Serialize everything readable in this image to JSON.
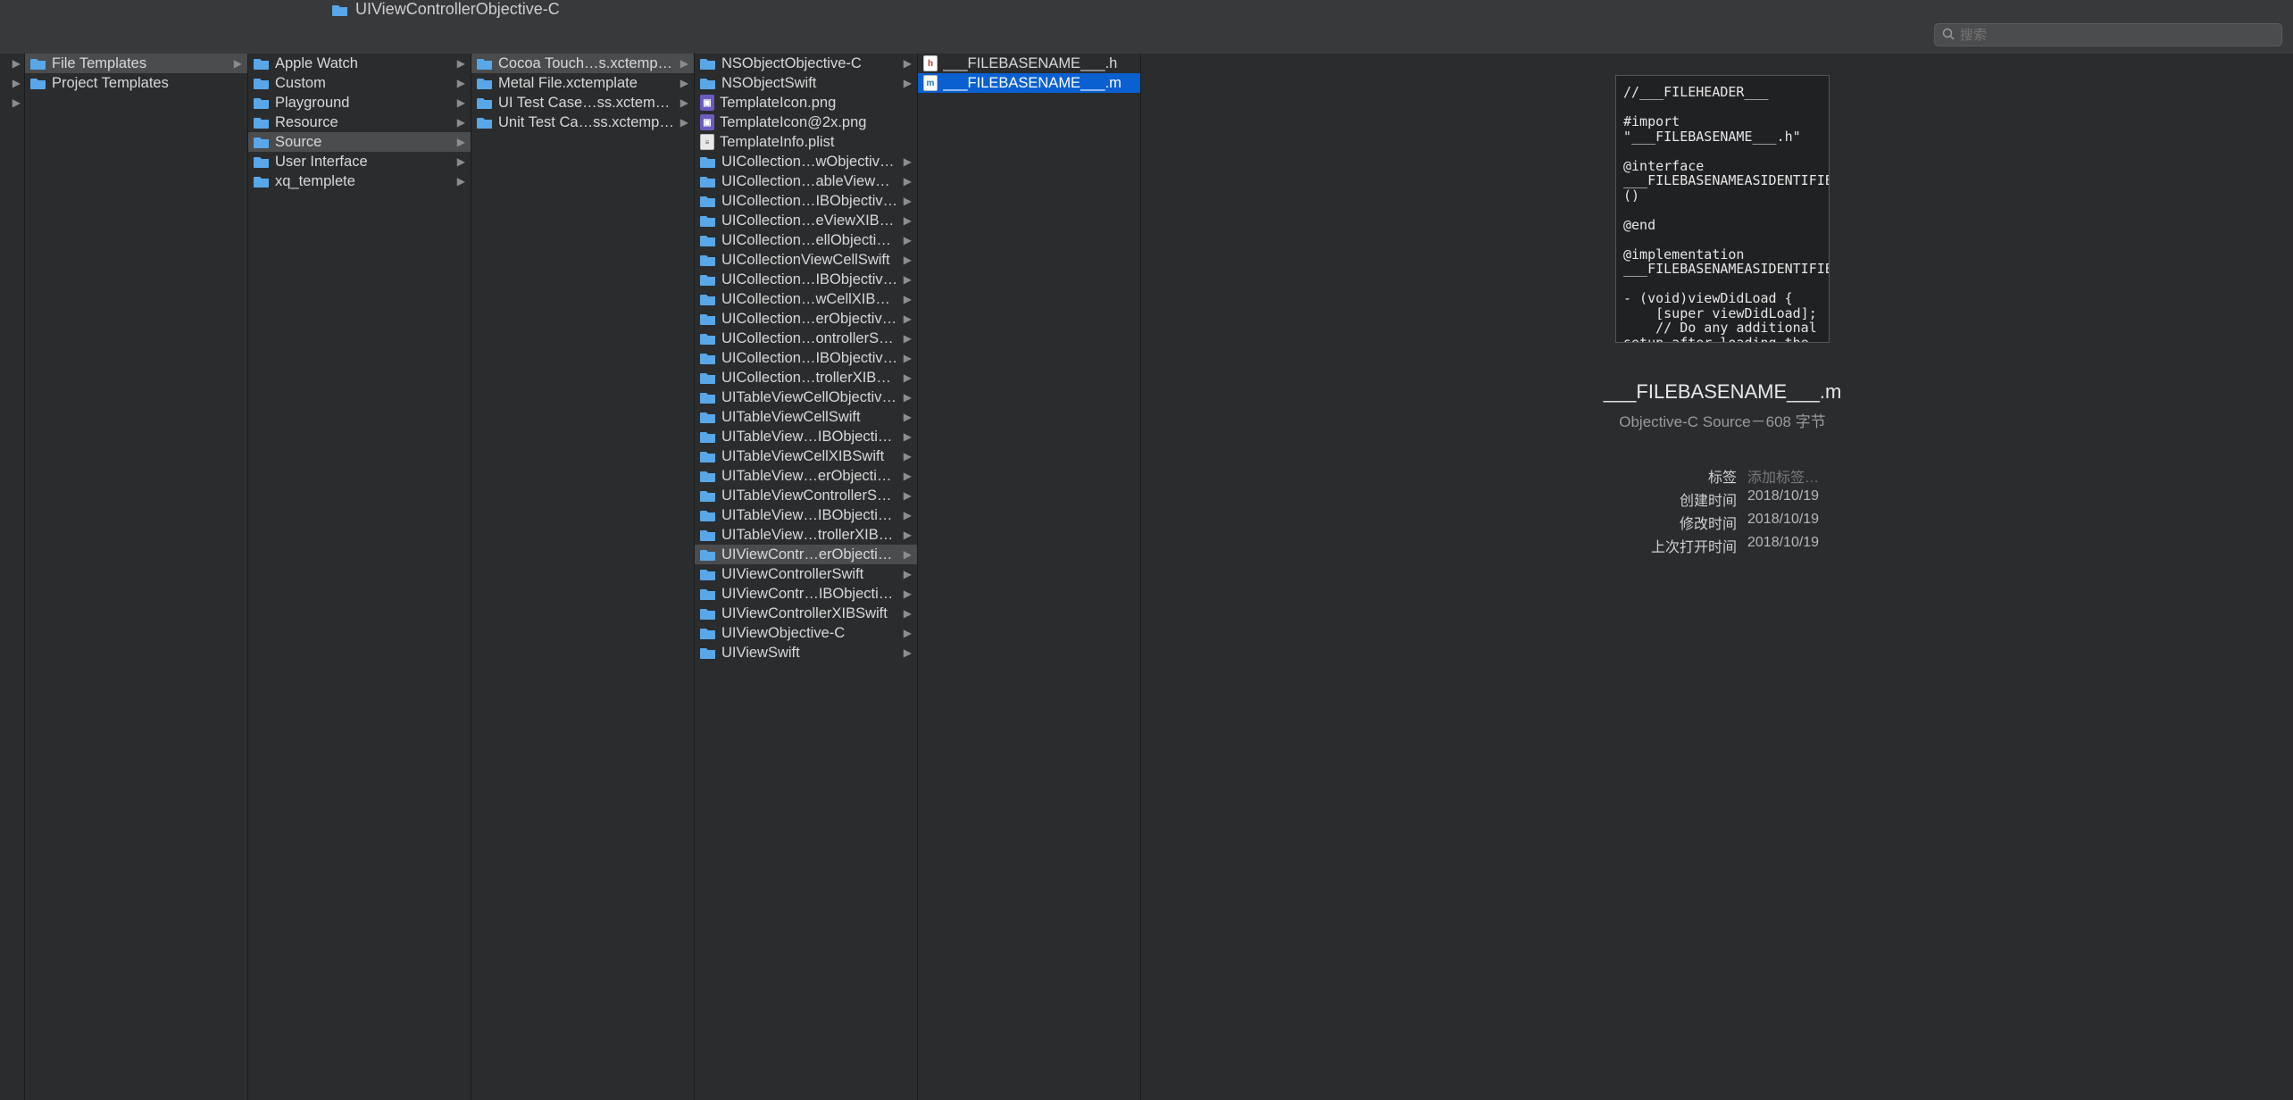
{
  "toolbar": {
    "path_title": "UIViewControllerObjective-C",
    "search_placeholder": "搜索"
  },
  "col0_rows": 3,
  "col1": [
    {
      "label": "File Templates",
      "type": "folder",
      "arrow": true,
      "sel": "path"
    },
    {
      "label": "Project Templates",
      "type": "folder",
      "arrow": false
    }
  ],
  "col2": [
    {
      "label": "Apple Watch",
      "type": "folder",
      "arrow": true
    },
    {
      "label": "Custom",
      "type": "folder",
      "arrow": true
    },
    {
      "label": "Playground",
      "type": "folder",
      "arrow": true
    },
    {
      "label": "Resource",
      "type": "folder",
      "arrow": true
    },
    {
      "label": "Source",
      "type": "folder",
      "arrow": true,
      "sel": "path"
    },
    {
      "label": "User Interface",
      "type": "folder",
      "arrow": true
    },
    {
      "label": "xq_templete",
      "type": "folder",
      "arrow": true
    }
  ],
  "col3": [
    {
      "label": "Cocoa Touch…s.xctemplate",
      "type": "folder",
      "arrow": true,
      "sel": "path"
    },
    {
      "label": "Metal File.xctemplate",
      "type": "folder",
      "arrow": true
    },
    {
      "label": "UI Test Case…ss.xctemplate",
      "type": "folder",
      "arrow": true
    },
    {
      "label": "Unit Test Ca…ss.xctemplate",
      "type": "folder",
      "arrow": true
    }
  ],
  "col4": [
    {
      "label": "NSObjectObjective-C",
      "type": "folder",
      "arrow": true
    },
    {
      "label": "NSObjectSwift",
      "type": "folder",
      "arrow": true
    },
    {
      "label": "TemplateIcon.png",
      "type": "png",
      "arrow": false
    },
    {
      "label": "TemplateIcon@2x.png",
      "type": "png",
      "arrow": false
    },
    {
      "label": "TemplateInfo.plist",
      "type": "plist",
      "arrow": false
    },
    {
      "label": "UICollection…wObjective-C",
      "type": "folder",
      "arrow": true
    },
    {
      "label": "UICollection…ableViewSwift",
      "type": "folder",
      "arrow": true
    },
    {
      "label": "UICollection…IBObjective-C",
      "type": "folder",
      "arrow": true
    },
    {
      "label": "UICollection…eViewXIBSwift",
      "type": "folder",
      "arrow": true
    },
    {
      "label": "UICollection…ellObjective-C",
      "type": "folder",
      "arrow": true
    },
    {
      "label": "UICollectionViewCellSwift",
      "type": "folder",
      "arrow": true
    },
    {
      "label": "UICollection…IBObjective-C",
      "type": "folder",
      "arrow": true
    },
    {
      "label": "UICollection…wCellXIBSwift",
      "type": "folder",
      "arrow": true
    },
    {
      "label": "UICollection…erObjective-C",
      "type": "folder",
      "arrow": true
    },
    {
      "label": "UICollection…ontrollerSwift",
      "type": "folder",
      "arrow": true
    },
    {
      "label": "UICollection…IBObjective-C",
      "type": "folder",
      "arrow": true
    },
    {
      "label": "UICollection…trollerXIBSwift",
      "type": "folder",
      "arrow": true
    },
    {
      "label": "UITableViewCellObjective-C",
      "type": "folder",
      "arrow": true
    },
    {
      "label": "UITableViewCellSwift",
      "type": "folder",
      "arrow": true
    },
    {
      "label": "UITableView…IBObjective-C",
      "type": "folder",
      "arrow": true
    },
    {
      "label": "UITableViewCellXIBSwift",
      "type": "folder",
      "arrow": true
    },
    {
      "label": "UITableView…erObjective-C",
      "type": "folder",
      "arrow": true
    },
    {
      "label": "UITableViewControllerSwift",
      "type": "folder",
      "arrow": true
    },
    {
      "label": "UITableView…IBObjective-C",
      "type": "folder",
      "arrow": true
    },
    {
      "label": "UITableView…trollerXIBSwift",
      "type": "folder",
      "arrow": true
    },
    {
      "label": "UIViewContr…erObjective-C",
      "type": "folder",
      "arrow": true,
      "sel": "path"
    },
    {
      "label": "UIViewControllerSwift",
      "type": "folder",
      "arrow": true
    },
    {
      "label": "UIViewContr…IBObjective-C",
      "type": "folder",
      "arrow": true
    },
    {
      "label": "UIViewControllerXIBSwift",
      "type": "folder",
      "arrow": true
    },
    {
      "label": "UIViewObjective-C",
      "type": "folder",
      "arrow": true
    },
    {
      "label": "UIViewSwift",
      "type": "folder",
      "arrow": true
    }
  ],
  "col5": [
    {
      "label": "___FILEBASENAME___.h",
      "type": "h",
      "arrow": false
    },
    {
      "label": "___FILEBASENAME___.m",
      "type": "m",
      "arrow": false,
      "sel": "active"
    }
  ],
  "preview": {
    "code": "//___FILEHEADER___\n\n#import \"___FILEBASENAME___.h\"\n\n@interface ___FILEBASENAMEASIDENTIFIER___ ()\n\n@end\n\n@implementation ___FILEBASENAMEASIDENTIFIER___\n\n- (void)viewDidLoad {\n    [super viewDidLoad];\n    // Do any additional setup after loading the",
    "filename": "___FILEBASENAME___.m",
    "subtitle": "Objective-C Source－608 字节",
    "meta": {
      "tags_label": "标签",
      "tags_value": "添加标签…",
      "created_label": "创建时间",
      "created_value": "2018/10/19",
      "modified_label": "修改时间",
      "modified_value": "2018/10/19",
      "opened_label": "上次打开时间",
      "opened_value": "2018/10/19"
    }
  }
}
